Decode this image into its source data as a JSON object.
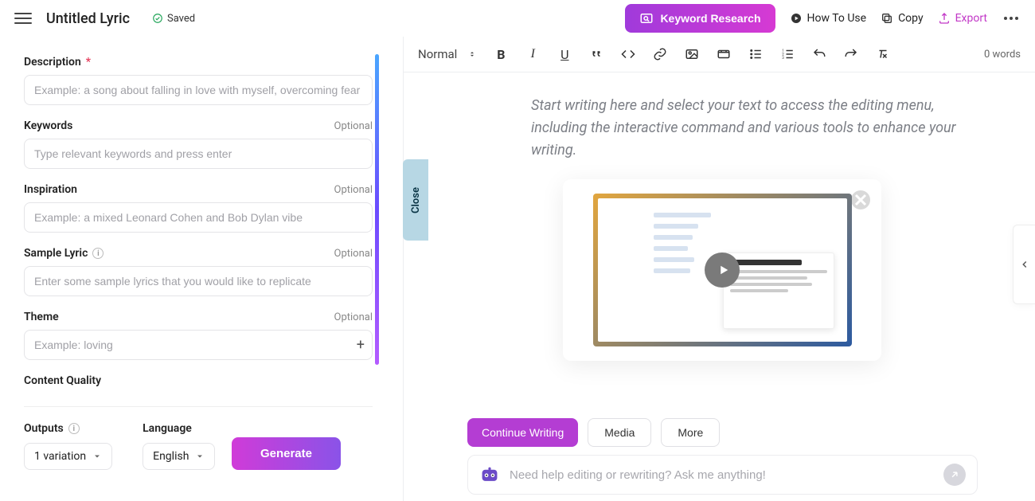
{
  "header": {
    "title": "Untitled Lyric",
    "saved_label": "Saved",
    "keyword_research": "Keyword Research",
    "how_to_use": "How To Use",
    "copy": "Copy",
    "export": "Export"
  },
  "form": {
    "description": {
      "label": "Description",
      "placeholder": "Example: a song about falling in love with myself, overcoming fear"
    },
    "keywords": {
      "label": "Keywords",
      "optional": "Optional",
      "placeholder": "Type relevant keywords and press enter"
    },
    "inspiration": {
      "label": "Inspiration",
      "optional": "Optional",
      "placeholder": "Example: a mixed Leonard Cohen and Bob Dylan vibe"
    },
    "sample": {
      "label": "Sample Lyric",
      "optional": "Optional",
      "placeholder": "Enter some sample lyrics that you would like to replicate"
    },
    "theme": {
      "label": "Theme",
      "optional": "Optional",
      "placeholder": "Example: loving"
    },
    "content_quality": {
      "label": "Content Quality"
    },
    "outputs": {
      "label": "Outputs",
      "value": "1 variation"
    },
    "language": {
      "label": "Language",
      "value": "English"
    },
    "generate": "Generate"
  },
  "close_tab": "Close",
  "editor": {
    "style_select": "Normal",
    "word_count": "0 words",
    "placeholder": "Start writing here and select your text to access the editing menu, including the interactive command and various tools to enhance your writing.",
    "continue": "Continue Writing",
    "media": "Media",
    "more": "More",
    "chat_placeholder": "Need help editing or rewriting? Ask me anything!"
  }
}
